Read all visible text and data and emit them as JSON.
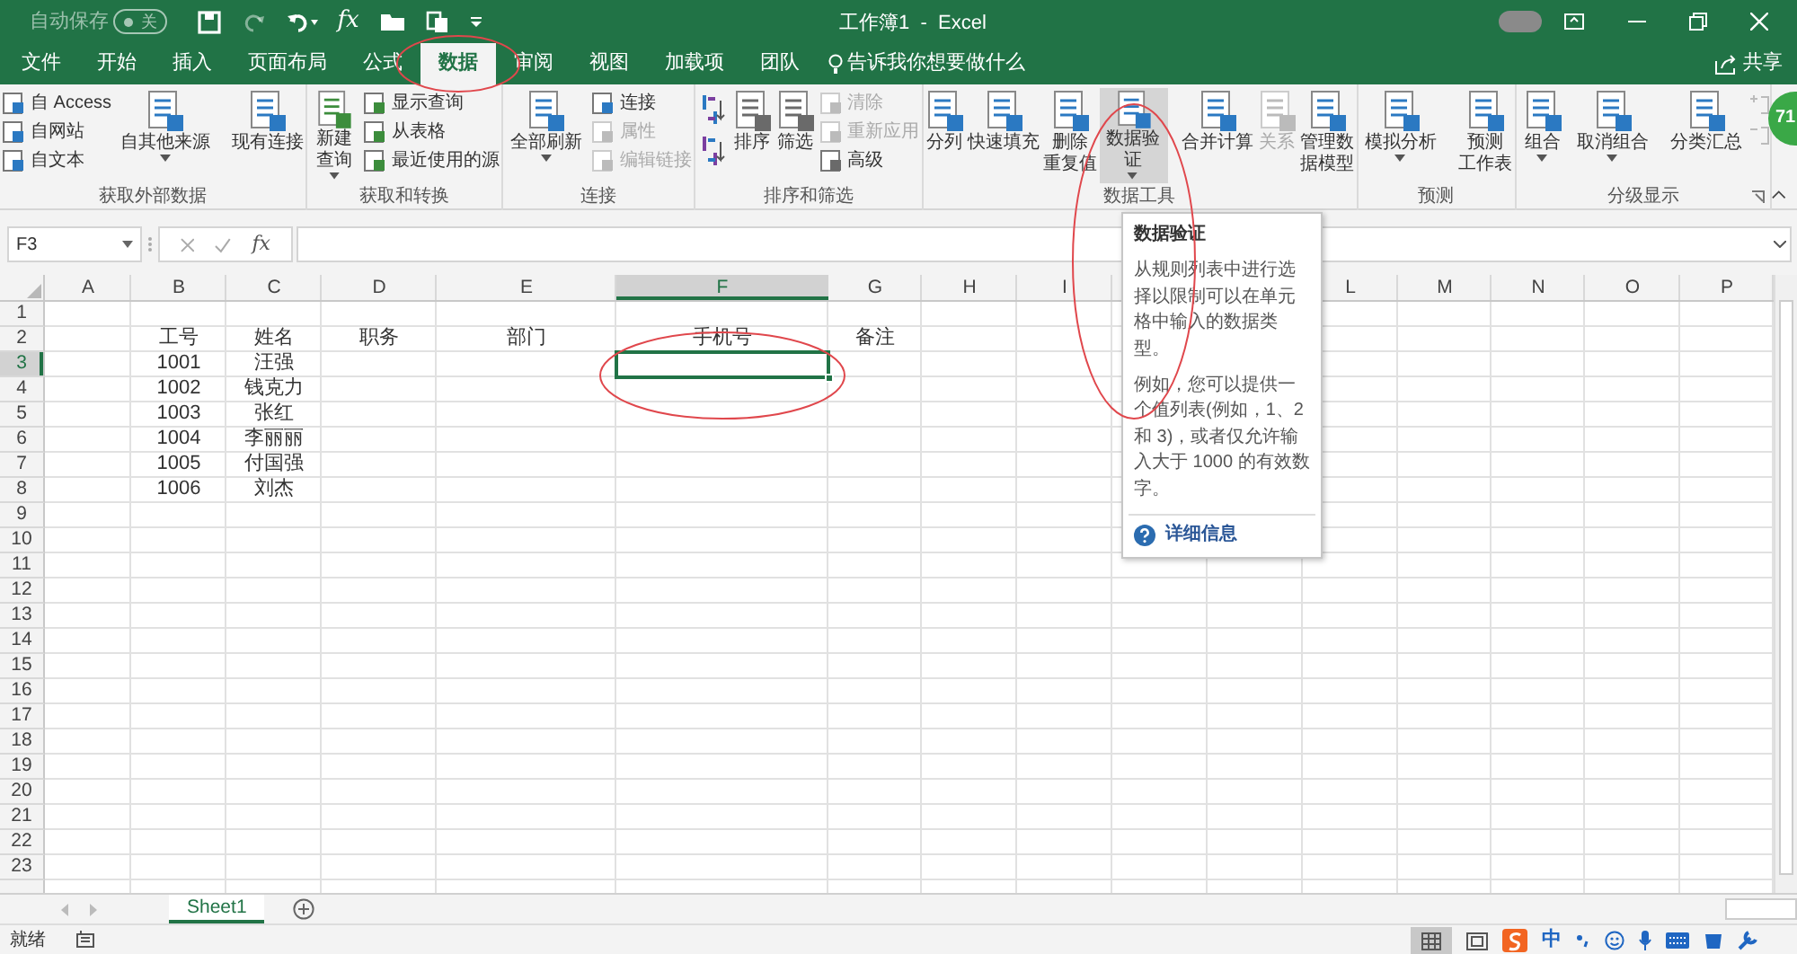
{
  "title_bar": {
    "autosave_label": "自动保存",
    "autosave_toggle": {
      "on": false,
      "label": "关"
    },
    "quick_access": [
      {
        "kind": "save",
        "disabled": false
      },
      {
        "kind": "redo",
        "disabled": true
      },
      {
        "kind": "undo",
        "disabled": false
      },
      {
        "kind": "fx",
        "label": "fx",
        "disabled": false
      },
      {
        "kind": "open",
        "disabled": false
      },
      {
        "kind": "copy",
        "disabled": false
      },
      {
        "kind": "customize",
        "disabled": false
      }
    ],
    "title": "工作簿1  -  Excel",
    "badge": "71"
  },
  "tabs": [
    {
      "label": "文件",
      "selected": false
    },
    {
      "label": "开始",
      "selected": false
    },
    {
      "label": "插入",
      "selected": false
    },
    {
      "label": "页面布局",
      "selected": false
    },
    {
      "label": "公式",
      "selected": false
    },
    {
      "label": "数据",
      "selected": true,
      "circled": true
    },
    {
      "label": "审阅",
      "selected": false
    },
    {
      "label": "视图",
      "selected": false
    },
    {
      "label": "加载项",
      "selected": false
    },
    {
      "label": "团队",
      "selected": false
    }
  ],
  "tell_me": "告诉我你想要做什么",
  "share": "共享",
  "ribbon_groups": [
    {
      "label": "获取外部数据",
      "controls": [
        {
          "kind": "stack",
          "items": [
            {
              "label": "自 Access",
              "disabled": false
            },
            {
              "label": "自网站",
              "disabled": false
            },
            {
              "label": "自文本",
              "disabled": false
            }
          ]
        },
        {
          "kind": "large",
          "lines": [
            "自其他来源"
          ],
          "menu": true,
          "disabled": false,
          "hovered": false
        },
        {
          "kind": "large",
          "lines": [
            "现有连接"
          ],
          "menu": false,
          "disabled": false,
          "hovered": false
        }
      ]
    },
    {
      "label": "获取和转换",
      "controls": [
        {
          "kind": "large",
          "lines": [
            "新建",
            "查询"
          ],
          "menu": true,
          "disabled": false,
          "hovered": false
        },
        {
          "kind": "stack",
          "items": [
            {
              "label": "显示查询",
              "disabled": false
            },
            {
              "label": "从表格",
              "disabled": false
            },
            {
              "label": "最近使用的源",
              "disabled": false
            }
          ]
        }
      ]
    },
    {
      "label": "连接",
      "controls": [
        {
          "kind": "large",
          "lines": [
            "全部刷新"
          ],
          "menu": true,
          "disabled": false,
          "hovered": false
        },
        {
          "kind": "stack",
          "items": [
            {
              "label": "连接",
              "disabled": false
            },
            {
              "label": "属性",
              "disabled": true
            },
            {
              "label": "编辑链接",
              "disabled": true
            }
          ]
        }
      ]
    },
    {
      "label": "排序和筛选",
      "controls": [
        {
          "kind": "sort_icons"
        },
        {
          "kind": "large",
          "lines": [
            "排序"
          ],
          "menu": false,
          "disabled": false,
          "hovered": false
        },
        {
          "kind": "large",
          "lines": [
            "筛选"
          ],
          "menu": false,
          "disabled": false,
          "hovered": false
        },
        {
          "kind": "stack",
          "items": [
            {
              "label": "清除",
              "disabled": true
            },
            {
              "label": "重新应用",
              "disabled": true
            },
            {
              "label": "高级",
              "disabled": false
            }
          ]
        }
      ]
    },
    {
      "label": "数据工具",
      "controls": [
        {
          "kind": "large",
          "lines": [
            "分列"
          ],
          "menu": false,
          "disabled": false,
          "hovered": false
        },
        {
          "kind": "large",
          "lines": [
            "快速填充"
          ],
          "menu": false,
          "disabled": false,
          "hovered": false
        },
        {
          "kind": "large",
          "lines": [
            "删除",
            "重复值"
          ],
          "menu": false,
          "disabled": false,
          "hovered": false
        },
        {
          "kind": "large",
          "lines": [
            "数据验",
            "证"
          ],
          "menu": true,
          "disabled": false,
          "hovered": true,
          "circled": true
        },
        {
          "kind": "large",
          "lines": [
            "合并计算"
          ],
          "menu": false,
          "disabled": false,
          "hovered": false
        },
        {
          "kind": "large",
          "lines": [
            "关系"
          ],
          "menu": false,
          "disabled": true,
          "hovered": false
        },
        {
          "kind": "large",
          "lines": [
            "管理数",
            "据模型"
          ],
          "menu": false,
          "disabled": false,
          "hovered": false
        }
      ]
    },
    {
      "label": "预测",
      "controls": [
        {
          "kind": "large",
          "lines": [
            "模拟分析"
          ],
          "menu": true,
          "disabled": false,
          "hovered": false
        },
        {
          "kind": "large",
          "lines": [
            "预测",
            "工作表"
          ],
          "menu": false,
          "disabled": false,
          "hovered": false
        }
      ]
    },
    {
      "label": "分级显示",
      "launcher": true,
      "controls": [
        {
          "kind": "large",
          "lines": [
            "组合"
          ],
          "menu": true,
          "disabled": false,
          "hovered": false
        },
        {
          "kind": "large",
          "lines": [
            "取消组合"
          ],
          "menu": true,
          "disabled": false,
          "hovered": false
        },
        {
          "kind": "large",
          "lines": [
            "分类汇总"
          ],
          "menu": false,
          "disabled": false,
          "hovered": false
        },
        {
          "kind": "outline_icons"
        }
      ]
    }
  ],
  "formula_bar": {
    "name_box": "F3",
    "fx": "fx"
  },
  "sheet": {
    "columns": [
      {
        "letter": "A",
        "selected": false
      },
      {
        "letter": "B",
        "selected": false
      },
      {
        "letter": "C",
        "selected": false
      },
      {
        "letter": "D",
        "selected": false
      },
      {
        "letter": "E",
        "selected": false
      },
      {
        "letter": "F",
        "selected": true
      },
      {
        "letter": "G",
        "selected": false
      },
      {
        "letter": "H",
        "selected": false
      },
      {
        "letter": "I",
        "selected": false
      },
      {},
      {},
      {
        "letter": "L",
        "selected": false
      },
      {
        "letter": "M",
        "selected": false
      },
      {
        "letter": "N",
        "selected": false
      },
      {
        "letter": "O",
        "selected": false
      },
      {
        "letter": "P",
        "selected": false
      }
    ],
    "rows": [
      {
        "number": "1",
        "selected": false
      },
      {
        "number": "2",
        "selected": false,
        "cells": {
          "B": "工号",
          "C": "姓名",
          "D": "职务",
          "E": "部门",
          "F": "手机号",
          "G": "备注"
        }
      },
      {
        "number": "3",
        "selected": true,
        "circled": true,
        "cells": {
          "B": "1001",
          "C": "汪强"
        }
      },
      {
        "number": "4",
        "selected": false,
        "cells": {
          "B": "1002",
          "C": "钱克力"
        }
      },
      {
        "number": "5",
        "selected": false,
        "cells": {
          "B": "1003",
          "C": "张红"
        }
      },
      {
        "number": "6",
        "selected": false,
        "cells": {
          "B": "1004",
          "C": "李丽丽"
        }
      },
      {
        "number": "7",
        "selected": false,
        "cells": {
          "B": "1005",
          "C": "付国强"
        }
      },
      {
        "number": "8",
        "selected": false,
        "cells": {
          "B": "1006",
          "C": "刘杰"
        }
      },
      {
        "number": "9",
        "selected": false
      },
      {
        "number": "10",
        "selected": false
      },
      {
        "number": "11",
        "selected": false
      },
      {
        "number": "12",
        "selected": false
      },
      {
        "number": "13",
        "selected": false
      },
      {
        "number": "14",
        "selected": false
      },
      {
        "number": "15",
        "selected": false
      },
      {
        "number": "16",
        "selected": false
      },
      {
        "number": "17",
        "selected": false
      },
      {
        "number": "18",
        "selected": false
      },
      {
        "number": "19",
        "selected": false
      },
      {
        "number": "20",
        "selected": false
      },
      {
        "number": "21",
        "selected": false
      },
      {
        "number": "22",
        "selected": false
      },
      {
        "number": "23",
        "selected": false
      }
    ]
  },
  "tooltip": {
    "title": "数据验证",
    "paragraphs": [
      "从规则列表中进行选择以限制可以在单元格中输入的数据类型。",
      "例如，您可以提供一个值列表(例如，1、2 和 3)，或者仅允许输入大于 1000 的有效数字。"
    ],
    "link": "详细信息"
  },
  "sheet_tabs": [
    {
      "label": "Sheet1",
      "selected": true
    }
  ],
  "status_bar": {
    "text": "就绪",
    "ime_label": "中"
  }
}
